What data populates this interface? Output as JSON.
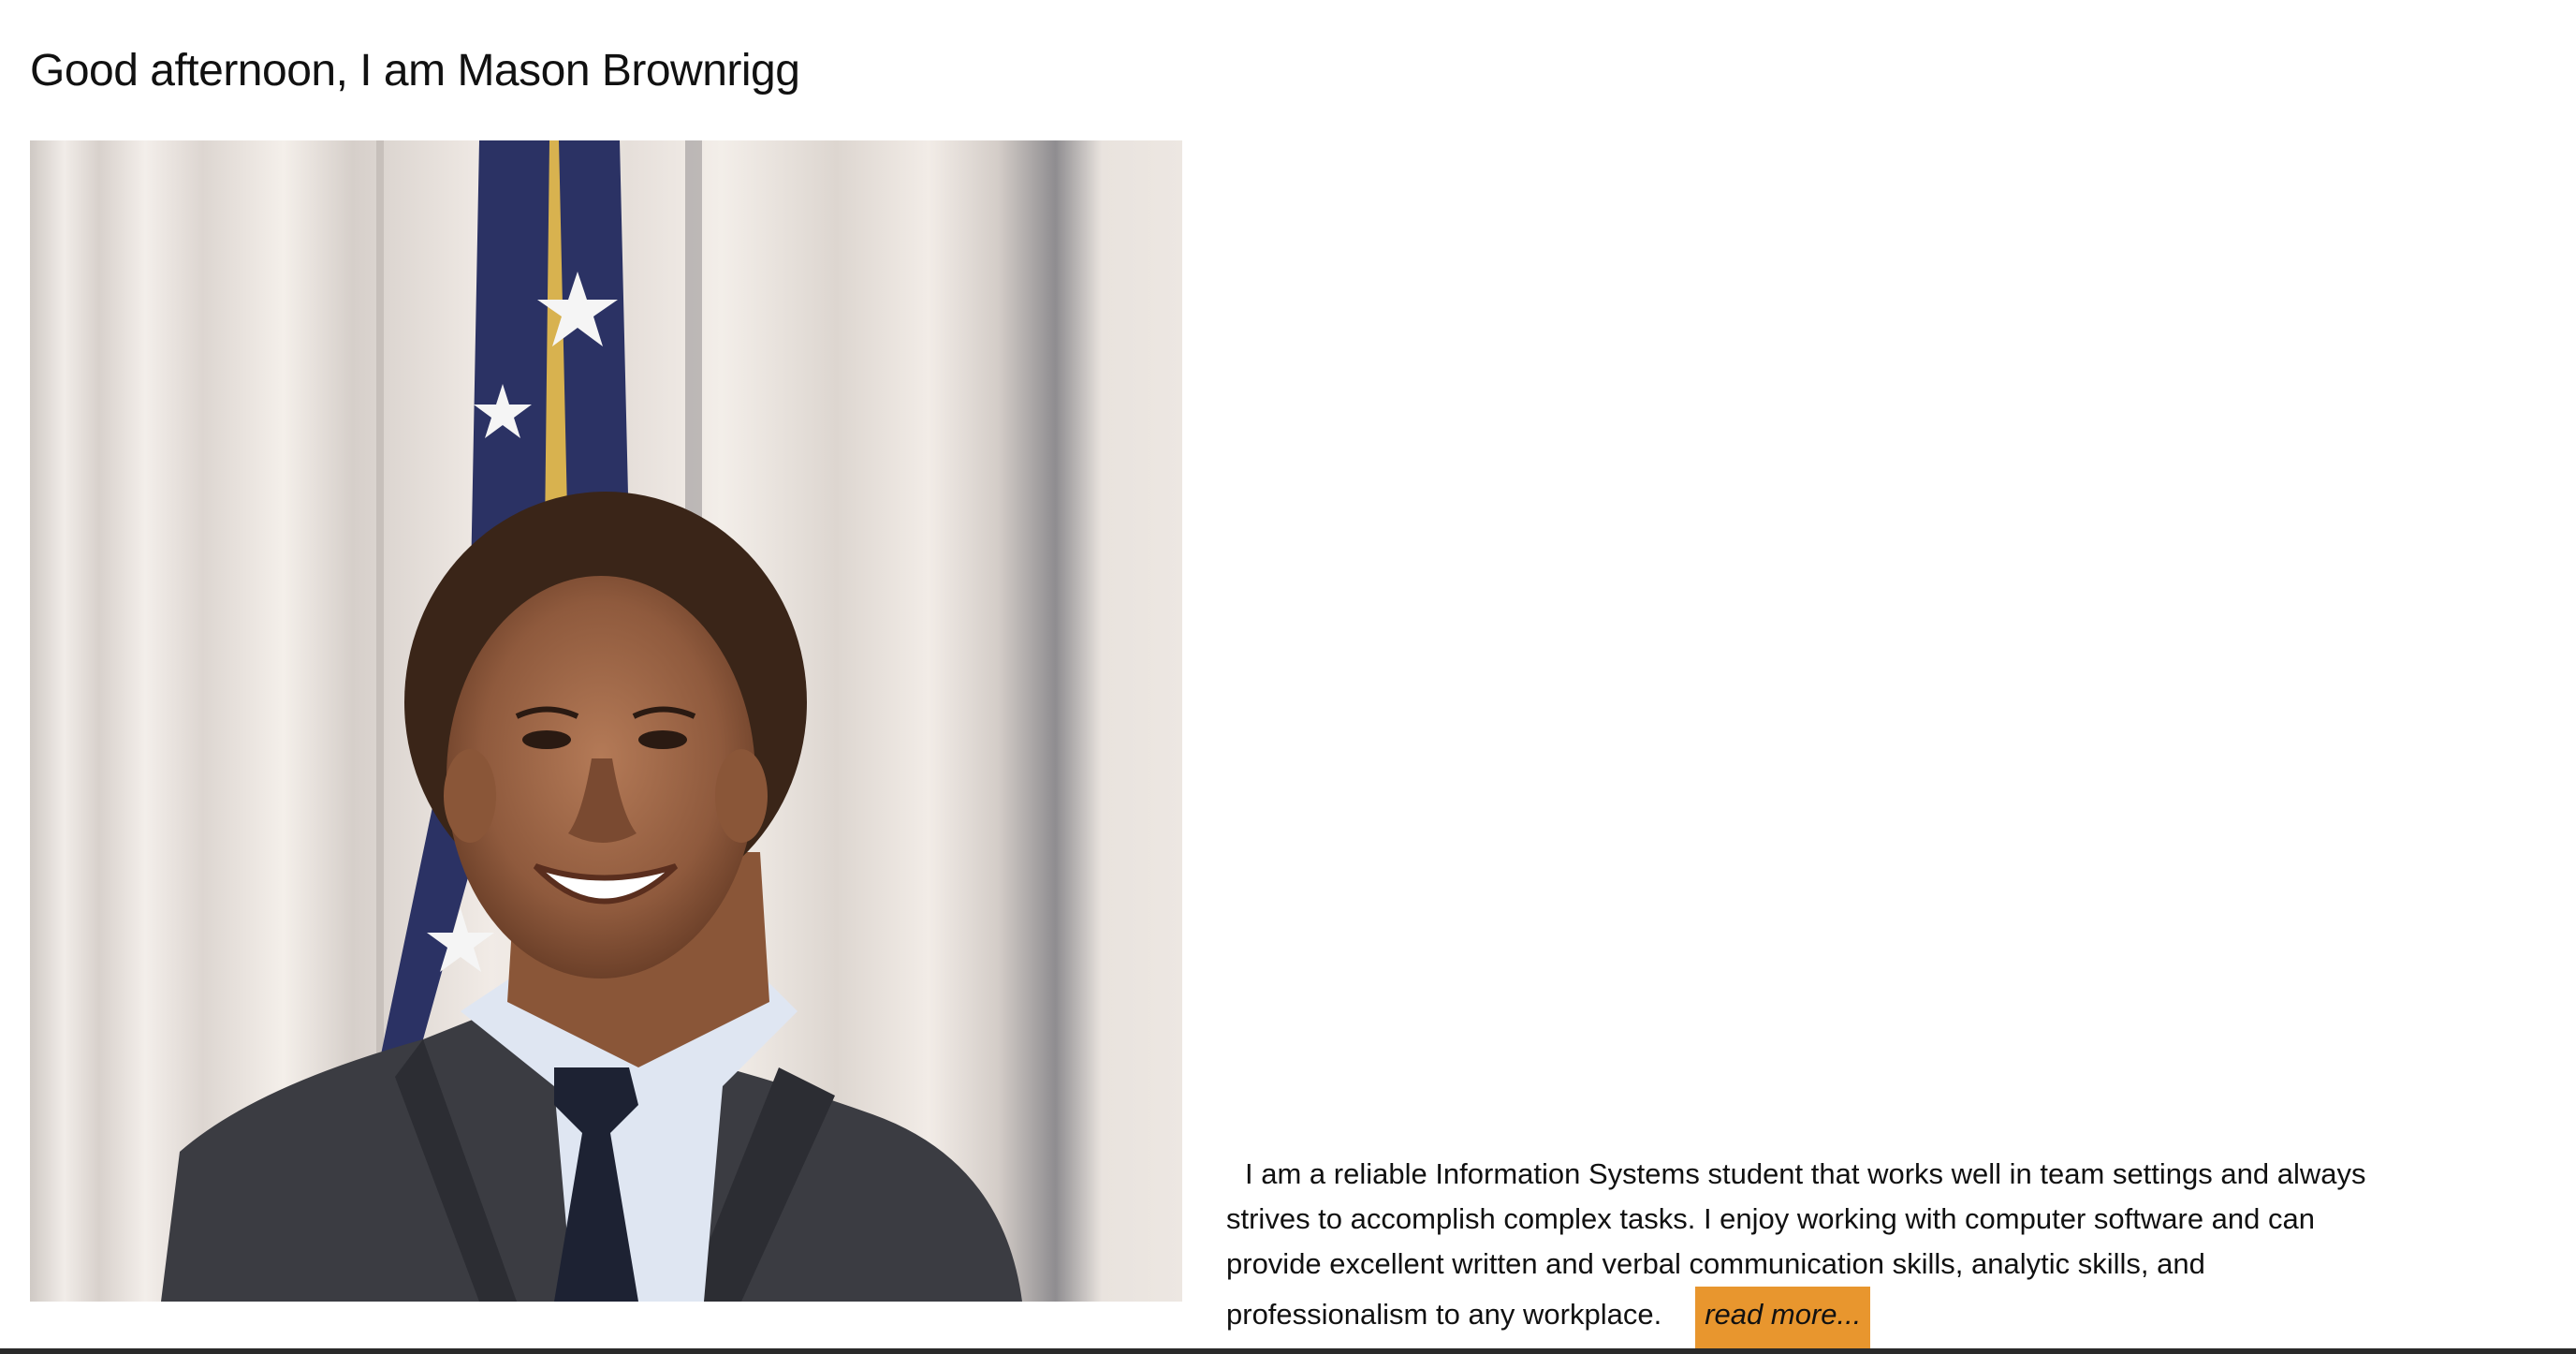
{
  "header": {
    "greeting": "Good afternoon, I am Mason Brownrigg"
  },
  "profile_photo": {
    "icon": "portrait-photo"
  },
  "bio": {
    "text": "I am a reliable Information Systems student that works well in team settings and always strives to accomplish complex tasks. I enjoy working with computer software and can provide excellent written and verbal communication skills, analytic skills, and professionalism to any workplace.",
    "read_more_label": "read more..."
  },
  "colors": {
    "accent": "#e8962e",
    "text": "#111111",
    "background": "#ffffff"
  }
}
